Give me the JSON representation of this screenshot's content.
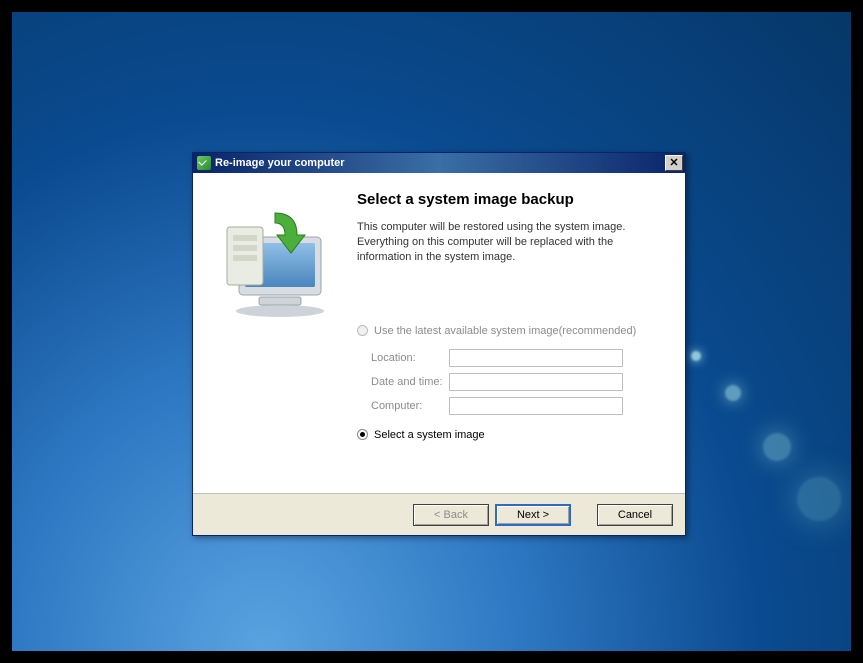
{
  "window": {
    "title": "Re-image your computer"
  },
  "page": {
    "heading": "Select a system image backup",
    "description": "This computer will be restored using the system image. Everything on this computer will be replaced with the information in the system image."
  },
  "options": {
    "latest": {
      "label": "Use the latest available system image(recommended)",
      "selected": false,
      "enabled": false
    },
    "fields": {
      "location": {
        "label": "Location:",
        "value": ""
      },
      "datetime": {
        "label": "Date and time:",
        "value": ""
      },
      "computer": {
        "label": "Computer:",
        "value": ""
      }
    },
    "select": {
      "label": "Select a system image",
      "selected": true,
      "enabled": true
    }
  },
  "buttons": {
    "back": "< Back",
    "next": "Next >",
    "cancel": "Cancel"
  }
}
